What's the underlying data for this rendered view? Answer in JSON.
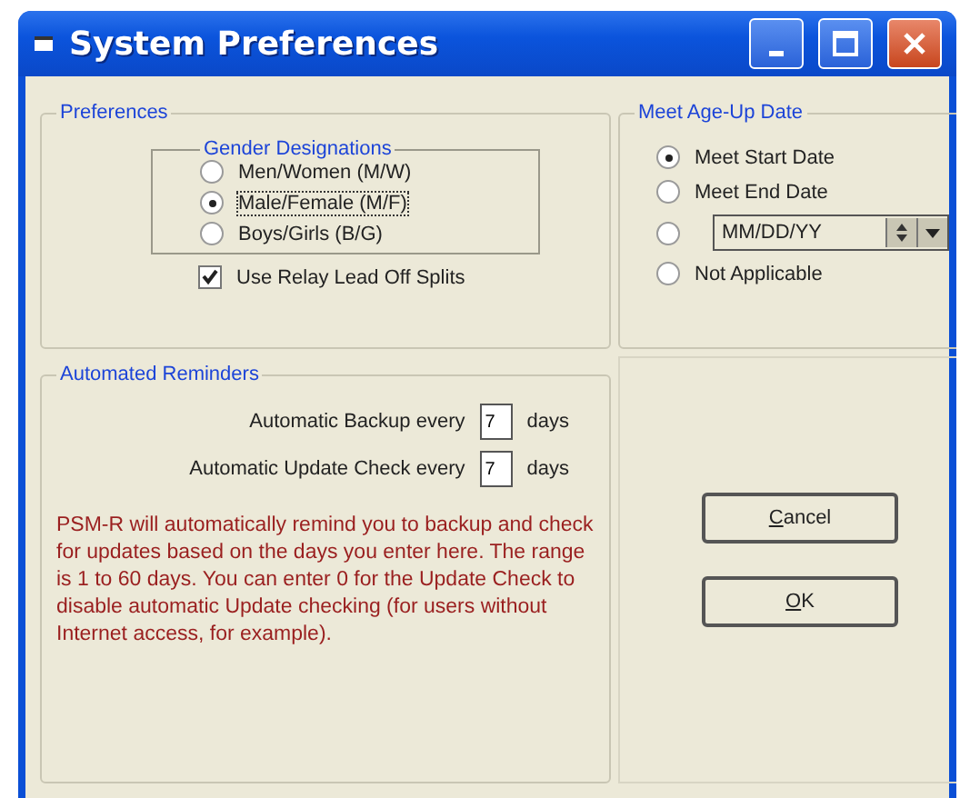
{
  "window": {
    "title": "System Preferences"
  },
  "preferences": {
    "title": "Preferences",
    "gender_group": {
      "title": "Gender Designations",
      "options": [
        {
          "label": "Men/Women (M/W)",
          "selected": false
        },
        {
          "label": "Male/Female (M/F)",
          "selected": true
        },
        {
          "label": "Boys/Girls (B/G)",
          "selected": false
        }
      ]
    },
    "relay_splits": {
      "label": "Use Relay Lead Off Splits",
      "checked": true
    }
  },
  "age_up": {
    "title": "Meet Age-Up Date",
    "options": [
      {
        "kind": "label",
        "label": "Meet Start Date",
        "selected": true
      },
      {
        "kind": "label",
        "label": "Meet End Date",
        "selected": false
      },
      {
        "kind": "date",
        "value": "MM/DD/YY",
        "selected": false
      },
      {
        "kind": "label",
        "label": "Not Applicable",
        "selected": false
      }
    ]
  },
  "reminders": {
    "title": "Automated Reminders",
    "rows": [
      {
        "label": "Automatic Backup every",
        "value": "7",
        "unit": "days"
      },
      {
        "label": "Automatic Update Check every",
        "value": "7",
        "unit": "days"
      }
    ],
    "note": "PSM-R will automatically remind you to backup and check for updates based on the days you enter here.  The range is 1 to 60 days.  You can enter 0 for the Update Check to disable automatic Update checking (for users without Internet access, for example)."
  },
  "buttons": [
    {
      "label": "Cancel",
      "mnemonic_underlined": true
    },
    {
      "label": "OK",
      "mnemonic_underlined": true
    }
  ]
}
